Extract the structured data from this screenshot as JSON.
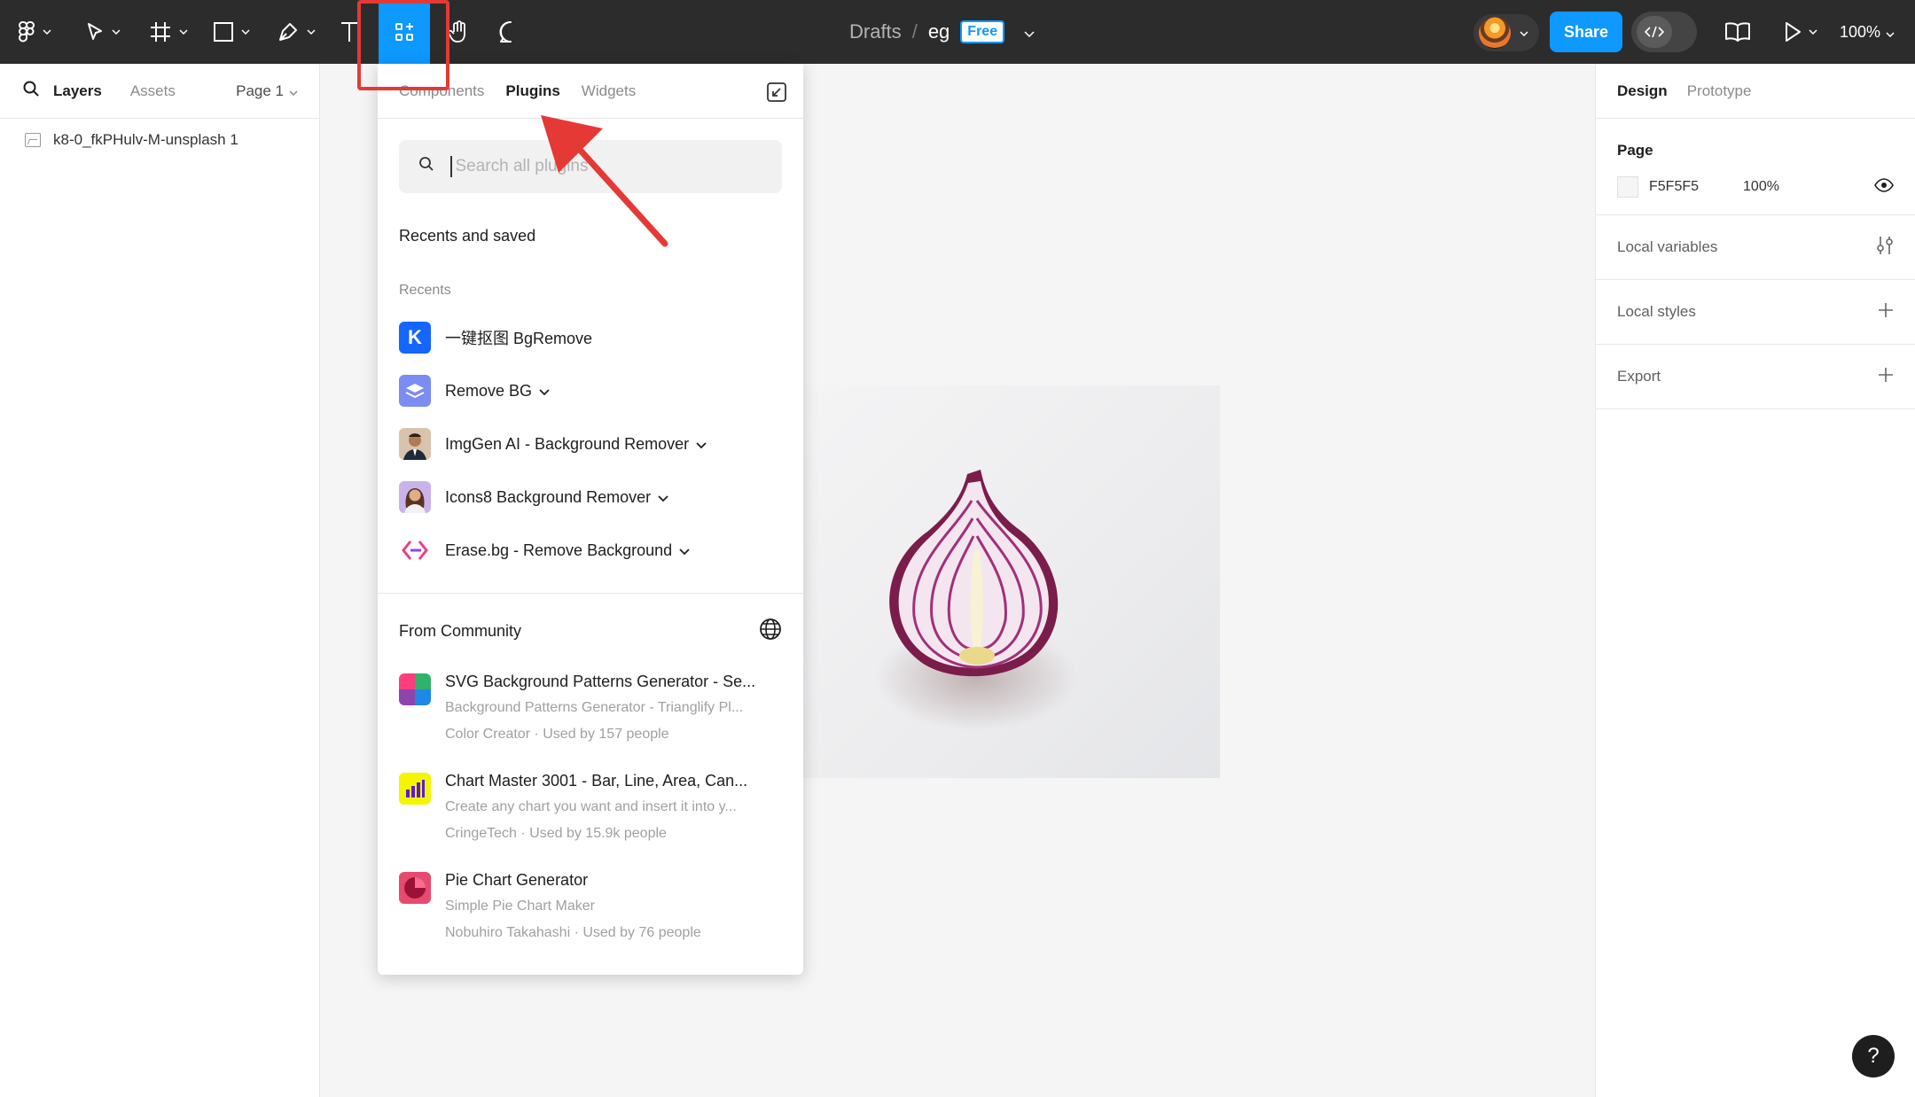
{
  "toolbar": {
    "title_drafts": "Drafts",
    "title_separator": "/",
    "file_name": "eg",
    "plan_badge": "Free",
    "share_label": "Share",
    "zoom_label": "100%"
  },
  "left_panel": {
    "tab_layers": "Layers",
    "tab_assets": "Assets",
    "page_label": "Page 1",
    "layers": [
      "k8-0_fkPHulv-M-unsplash 1"
    ]
  },
  "plugin_panel": {
    "tabs": [
      "Components",
      "Plugins",
      "Widgets"
    ],
    "active_tab": "Plugins",
    "search_placeholder": "Search all plugins",
    "recents_saved_heading": "Recents and saved",
    "recents_label": "Recents",
    "recents": [
      {
        "name": "一键抠图 BgRemove",
        "icon": "k-logo-icon",
        "color": "#1565ff",
        "has_chevron": false
      },
      {
        "name": "Remove BG",
        "icon": "layers-logo-icon",
        "color": "#7b8cf2",
        "has_chevron": true
      },
      {
        "name": "ImgGen AI - Background Remover",
        "icon": "man-portrait-icon",
        "color": "#c9a27a",
        "has_chevron": true
      },
      {
        "name": "Icons8 Background Remover",
        "icon": "woman-portrait-icon",
        "color": "#b08fe0",
        "has_chevron": true
      },
      {
        "name": "Erase.bg - Remove Background",
        "icon": "erase-logo-icon",
        "color": "#e83d8e",
        "has_chevron": true
      }
    ],
    "community_heading": "From Community",
    "community": [
      {
        "title": "SVG Background Patterns Generator - Se...",
        "desc": "Background Patterns Generator - Trianglify Pl...",
        "meta": "Color Creator · Used by 157 people",
        "icon": "pattern-logo-icon"
      },
      {
        "title": "Chart Master 3001 - Bar, Line, Area, Can...",
        "desc": "Create any chart you want and insert it into y...",
        "meta": "CringeTech · Used by 15.9k people",
        "icon": "bar-chart-logo-icon"
      },
      {
        "title": "Pie Chart Generator",
        "desc": "Simple Pie Chart Maker",
        "meta": "Nobuhiro Takahashi · Used by 76 people",
        "icon": "pie-chart-logo-icon"
      }
    ]
  },
  "right_panel": {
    "tab_design": "Design",
    "tab_prototype": "Prototype",
    "page_heading": "Page",
    "page_color": "F5F5F5",
    "page_opacity": "100%",
    "local_variables": "Local variables",
    "local_styles": "Local styles",
    "export": "Export"
  },
  "help_label": "?",
  "colors": {
    "accent": "#0d99ff",
    "toolbar_bg": "#2c2c2c",
    "highlight": "#e53935"
  }
}
